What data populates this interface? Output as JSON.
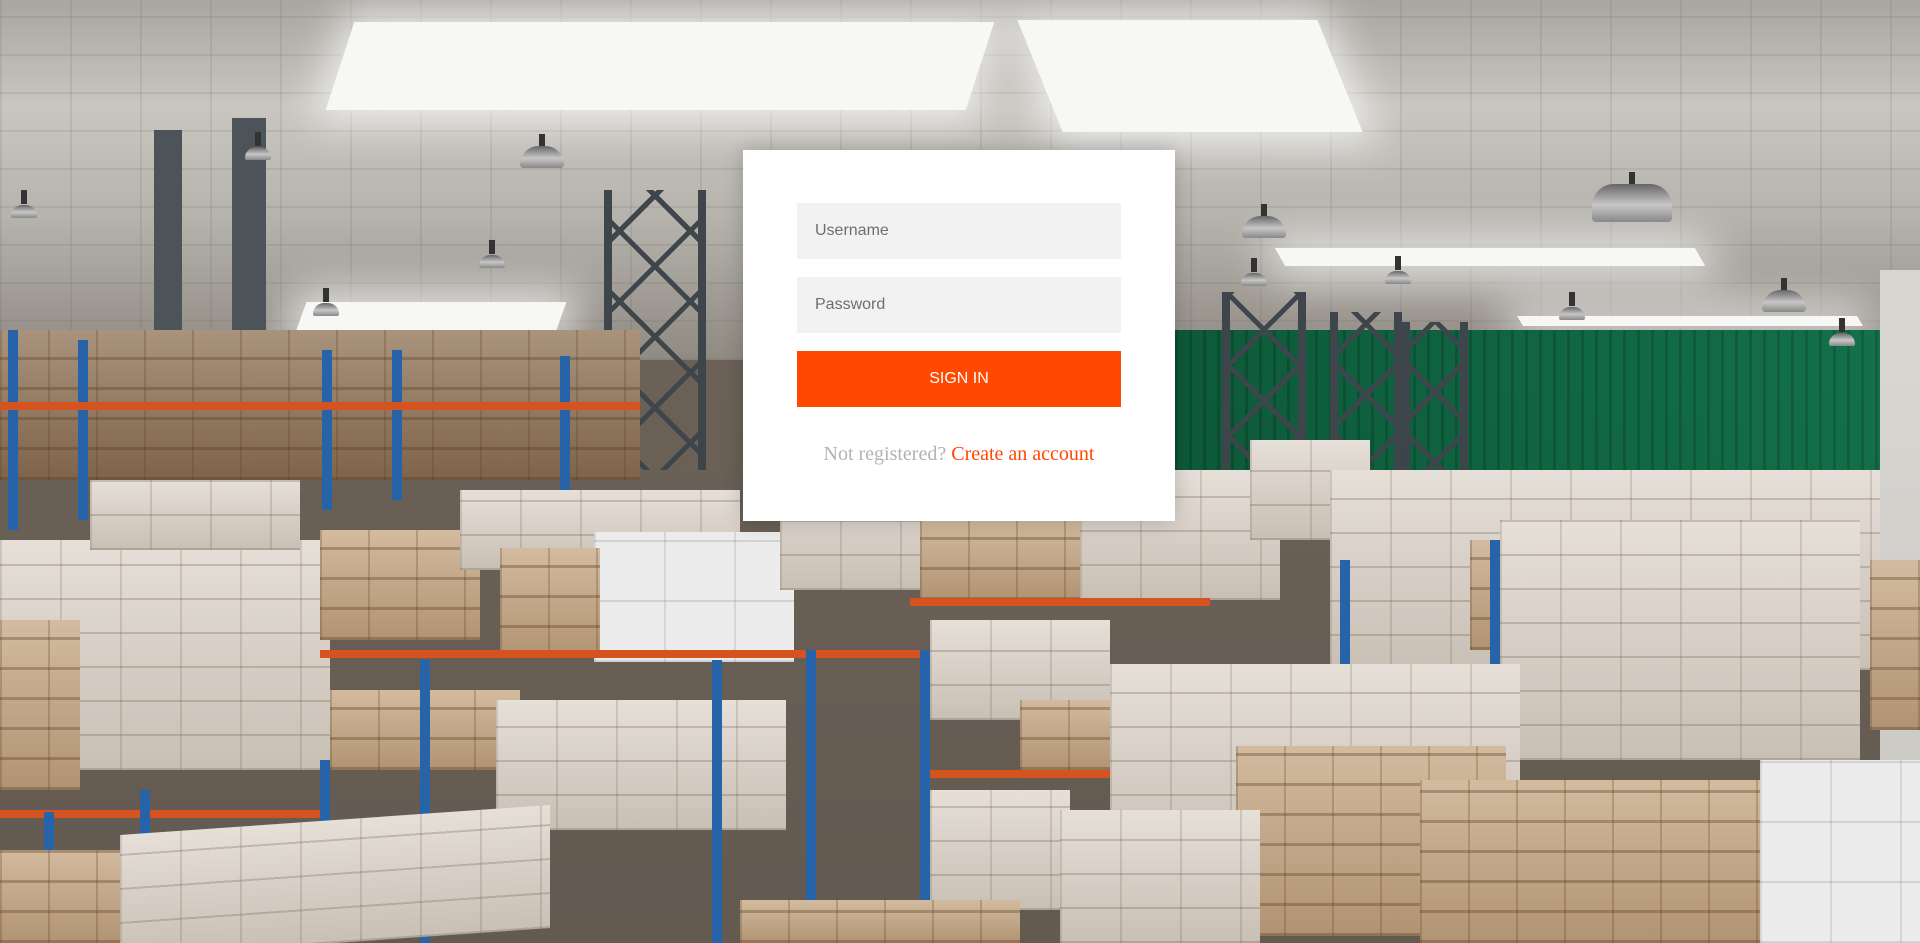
{
  "login_form": {
    "username": {
      "value": "",
      "placeholder": "Username"
    },
    "password": {
      "value": "",
      "placeholder": "Password"
    },
    "signin_label": "SIGN IN",
    "register_prompt": "Not registered?",
    "register_link": "Create an account"
  },
  "colors": {
    "accent": "#ff4800",
    "card_background": "#ffffff",
    "field_background": "#f2f2f2",
    "muted_text": "#b3b3b3"
  }
}
